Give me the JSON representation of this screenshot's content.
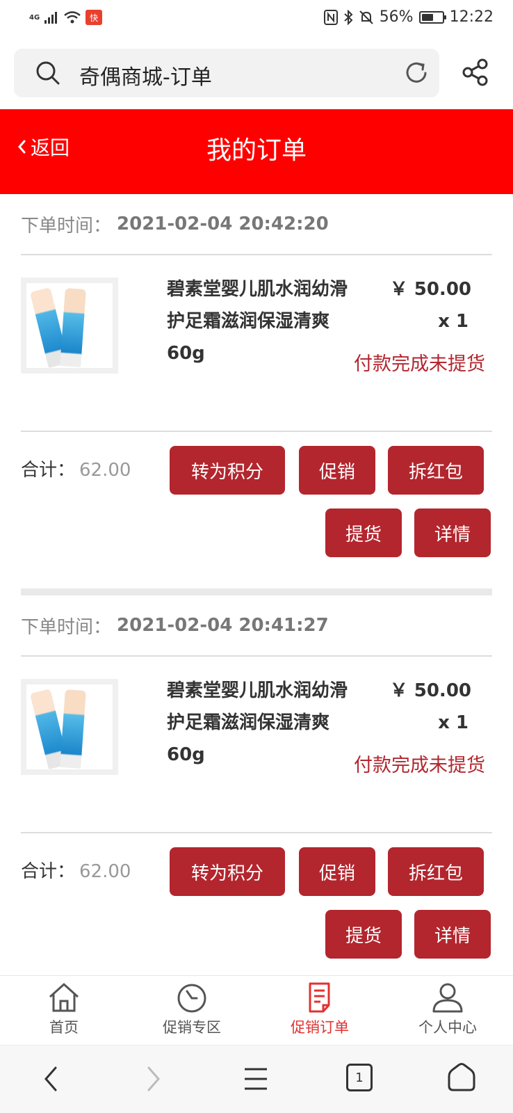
{
  "status_bar": {
    "network": "4G",
    "app_badge": "快",
    "battery_percent": "56%",
    "battery_level": 0.56,
    "time": "12:22"
  },
  "browser": {
    "address": "奇偶商城-订单"
  },
  "header": {
    "back_label": "返回",
    "title": "我的订单",
    "background_color": "#ff0000"
  },
  "orders": [
    {
      "time_label": "下单时间：",
      "time": "2021-02-04 20:42:20",
      "product_name": "碧素堂婴儿肌水润幼滑护足霜滋润保湿清爽60g",
      "price": "￥ 50.00",
      "quantity": "x 1",
      "status": "付款完成未提货",
      "total_label": "合计：",
      "total": "62.00",
      "buttons": {
        "points": "转为积分",
        "promo": "促销",
        "redpacket": "拆红包",
        "pickup": "提货",
        "details": "详情"
      }
    },
    {
      "time_label": "下单时间：",
      "time": "2021-02-04 20:41:27",
      "product_name": "碧素堂婴儿肌水润幼滑护足霜滋润保湿清爽60g",
      "price": "￥ 50.00",
      "quantity": "x 1",
      "status": "付款完成未提货",
      "total_label": "合计：",
      "total": "62.00",
      "buttons": {
        "points": "转为积分",
        "promo": "促销",
        "redpacket": "拆红包",
        "pickup": "提货",
        "details": "详情"
      }
    }
  ],
  "tabs": [
    {
      "label": "首页",
      "icon": "home-icon",
      "active": false
    },
    {
      "label": "促销专区",
      "icon": "timer-icon",
      "active": false
    },
    {
      "label": "促销订单",
      "icon": "order-doc-icon",
      "active": true
    },
    {
      "label": "个人中心",
      "icon": "user-icon",
      "active": false
    }
  ],
  "system_nav": {
    "tab_count": "1"
  },
  "colors": {
    "accent_red": "#b3262e",
    "active_tab": "#e23131",
    "header_red": "#ff0000"
  }
}
